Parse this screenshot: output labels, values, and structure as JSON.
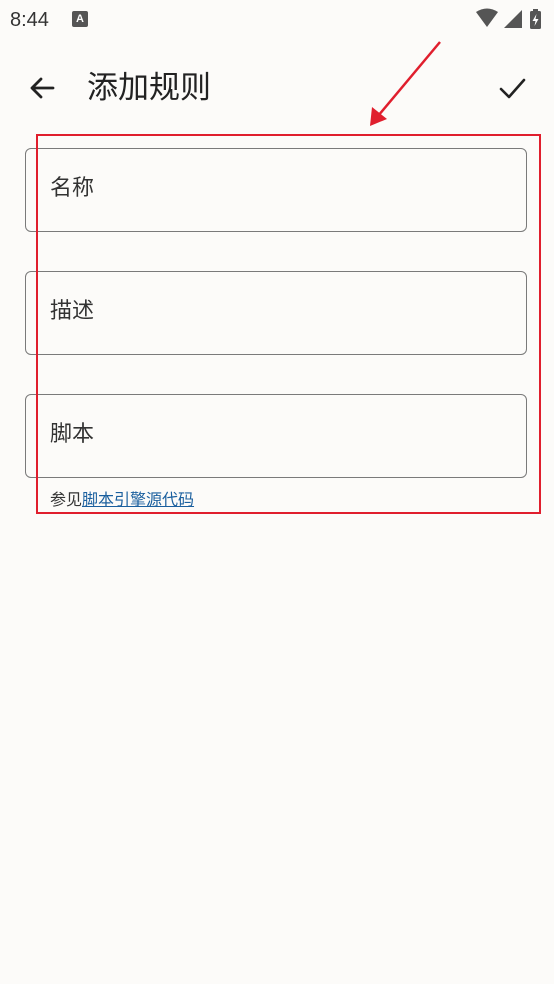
{
  "status_bar": {
    "time": "8:44",
    "notification_icon_letter": "A",
    "icons": [
      "wifi-icon",
      "signal-icon",
      "battery-charging-icon"
    ]
  },
  "app_bar": {
    "title": "添加规则",
    "back_icon": "arrow-left-icon",
    "save_icon": "checkmark-icon"
  },
  "form": {
    "fields": [
      {
        "label": "名称",
        "value": ""
      },
      {
        "label": "描述",
        "value": ""
      },
      {
        "label": "脚本",
        "value": ""
      }
    ],
    "helper_prefix": "参见",
    "helper_link": "脚本引擎源代码"
  },
  "colors": {
    "background": "#fcfbf9",
    "annotation": "#e01e2d",
    "link": "#1a5f9e",
    "outline": "#7a7a7a"
  }
}
